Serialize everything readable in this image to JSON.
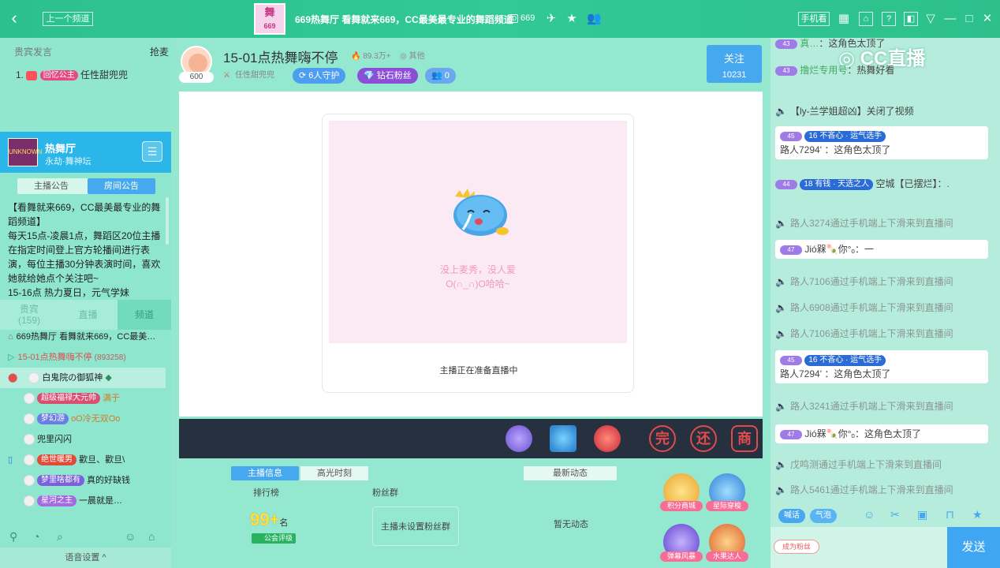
{
  "topbar": {
    "back_icon": "back-arrow-icon",
    "prev_channel": "上一个频道",
    "logo_text": "舞",
    "title": "669热舞厅 看舞就来669，CC最美最专业的舞蹈频道",
    "room_id": "669",
    "id_tag": "ID",
    "phone_label": "手机看",
    "help": "?"
  },
  "left": {
    "header_left": "贵宾发言",
    "header_right": "抢麦",
    "rank_no": "1.",
    "rank_badge": "回忆公主",
    "rank_name": "任性甜兜兜",
    "hall_name": "热舞厅",
    "hall_sub": "永劫·舞神坛",
    "hall_img_text": "UNKNOWN",
    "notice_tabs": [
      "主播公告",
      "房间公告"
    ],
    "notice_text": "【看舞就来669，CC最美最专业的舞蹈频道】\n每天15点-凌晨1点，舞蹈区20位主播在指定时间登上官方轮播间进行表演，每位主播30分钟表演时间，喜欢她就给她点个关注吧~\n15-16点 热力夏日，元气学妹",
    "chan_tabs": [
      {
        "label": "贵宾",
        "sub": "(159)"
      },
      {
        "label": "直播",
        "sub": ""
      },
      {
        "label": "频道",
        "sub": ""
      }
    ],
    "channel_title": "669热舞厅 看舞就来669，CC最美…",
    "room_line": "15-01点热舞嗨不停",
    "room_count": "(893258)",
    "users": [
      {
        "name": "白鬼院の御狐神",
        "badge": "",
        "tail": "",
        "badge_color": ""
      },
      {
        "name": "",
        "badge": "超级福禄大元帅",
        "tail": "满于",
        "badge_color": "#d84f72"
      },
      {
        "name": "",
        "badge": "梦幻游",
        "tail": "oO冷无双Oo",
        "badge_color": "#6b7fe0"
      },
      {
        "name": "兜里闪闪",
        "badge": "",
        "tail": "",
        "badge_color": ""
      },
      {
        "name": "",
        "badge": "绝世暖男",
        "tail": "歡旦、歡旦\\",
        "badge_color": "#e04c3a"
      },
      {
        "name": "",
        "badge": "梦里啥都有",
        "tail": "真的好缺钱",
        "badge_color": "#7b62d8"
      },
      {
        "name": "",
        "badge": "星河之主",
        "tail": "一晨就是…",
        "badge_color": "#a26be0"
      }
    ],
    "voice_setting": "语音设置 ^"
  },
  "center": {
    "anchor_level": "600",
    "room_title": "15-01点热舞嗨不停",
    "heat": "89.3万+",
    "other": "其他",
    "anchor_name": "任性甜兜兜",
    "guards": "6人守护",
    "diamond": "钻石粉丝",
    "fans_count": "0",
    "follow_label": "关注",
    "follow_count": "10231",
    "empty_line1": "没上麦秀，没人爱",
    "empty_line2": "O(∩_∩)O哈哈~",
    "preparing": "主播正在准备直播中",
    "gift_icons": [
      "完",
      "还",
      "商"
    ],
    "info_tabs": [
      "主播信息",
      "高光时刻"
    ],
    "news_tab": "最新动态",
    "rank_label": "排行榜",
    "fans_label": "粉丝群",
    "rank_value": "99",
    "rank_plus": "+",
    "rank_unit": "名",
    "guild_label": "公会评级",
    "fans_group_empty": "主播未设置粉丝群",
    "no_news": "暂无动态",
    "side_buttons": [
      "积分商城",
      "星际穿梭",
      "弹幕风暴",
      "水果达人"
    ],
    "colors": {
      "guard": "#4d9ef0",
      "diamond": "#8b4fd6",
      "follow": "#46a8ee"
    }
  },
  "right": {
    "brand": "CC直播",
    "messages": [
      {
        "type": "user",
        "level": "43",
        "name": "真…",
        "text": "：这角色太顶了",
        "card": false
      },
      {
        "type": "user",
        "level": "43",
        "name": "撸烂专用号",
        "text": "：热舞好看",
        "card": false
      },
      {
        "type": "sys",
        "text": "【ly-兰学姐超凶】关闭了视频"
      },
      {
        "type": "user",
        "level": "45",
        "name": "路人7294'",
        "text": "：这角色太顶了",
        "card": true,
        "badges": "16 不吝心 · 运气选手"
      },
      {
        "type": "user",
        "level": "44",
        "name": "空城【已摆烂】",
        "text": "：.",
        "card": false,
        "badges": "18 有钱 · 天选之人"
      },
      {
        "type": "sys",
        "text": "路人3274通过手机端上下滑来到直播间"
      },
      {
        "type": "user",
        "level": "47",
        "name": "Jió槑🍡你°ₒ",
        "text": "：一",
        "card": true
      },
      {
        "type": "sys",
        "text": "路人7106通过手机端上下滑来到直播间"
      },
      {
        "type": "sys",
        "text": "路人6908通过手机端上下滑来到直播间"
      },
      {
        "type": "sys",
        "text": "路人7106通过手机端上下滑来到直播间"
      },
      {
        "type": "user",
        "level": "45",
        "name": "路人7294'",
        "text": "：这角色太顶了",
        "card": true,
        "badges": "16 不吝心 · 运气选手"
      },
      {
        "type": "sys",
        "text": "路人3241通过手机端上下滑来到直播间"
      },
      {
        "type": "user",
        "level": "47",
        "name": "Jió槑🍡你°ₒ",
        "text": "：这角色太顶了",
        "card": true
      },
      {
        "type": "sys",
        "text": "戊鸣测通过手机端上下滑来到直播间"
      },
      {
        "type": "sys",
        "text": "路人5461通过手机端上下滑来到直播间"
      }
    ],
    "tool_shout": "喊话",
    "tool_bubble": "气泡",
    "fan_button": "成为粉丝",
    "send": "发送"
  }
}
